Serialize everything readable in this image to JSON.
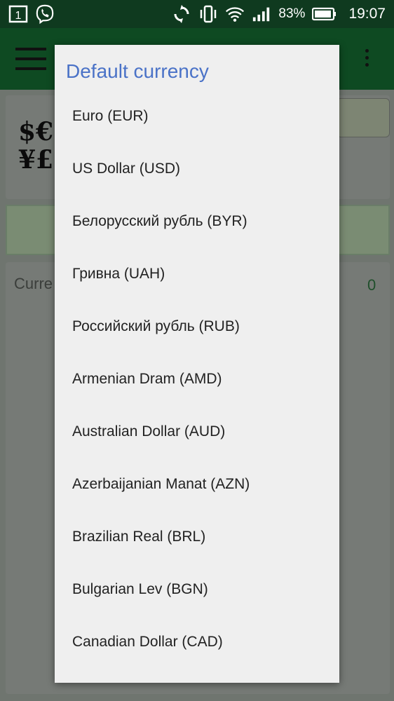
{
  "status_bar": {
    "notif_badge": "1",
    "battery": "83%",
    "time": "19:07"
  },
  "background": {
    "currency_symbols": "$€\n¥£",
    "currency_label": "Curre",
    "currency_value": "0"
  },
  "dialog": {
    "title": "Default currency",
    "options": [
      "Euro (EUR)",
      "US Dollar (USD)",
      "Белорусский рубль (BYR)",
      "Гривна (UAH)",
      "Российский рубль (RUB)",
      "Armenian Dram (AMD)",
      "Australian Dollar (AUD)",
      "Azerbaijanian Manat (AZN)",
      "Brazilian Real (BRL)",
      "Bulgarian Lev (BGN)",
      "Canadian Dollar (CAD)"
    ]
  },
  "colors": {
    "title_accent": "#4a72c7",
    "status_bar": "#0f3a1f",
    "toolbar": "#0e4a22"
  }
}
